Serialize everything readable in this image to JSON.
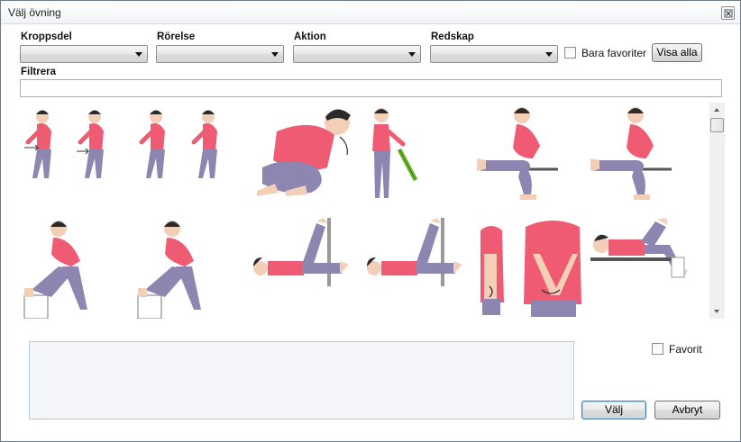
{
  "window": {
    "title": "Välj övning"
  },
  "filters": {
    "kroppsdel_label": "Kroppsdel",
    "kroppsdel_value": "",
    "rorelse_label": "Rörelse",
    "rorelse_value": "",
    "aktion_label": "Aktion",
    "aktion_value": "",
    "redskap_label": "Redskap",
    "redskap_value": "",
    "favorites_only_label": "Bara favoriter",
    "favorites_only_checked": false,
    "show_all_label": "Visa alla",
    "filter_label": "Filtrera",
    "filter_value": ""
  },
  "exercises": [
    {
      "icon": "forward-bend-arm-swing-icon"
    },
    {
      "icon": "forward-bend-arm-swing-icon"
    },
    {
      "icon": "kneeling-forward-bend-icon"
    },
    {
      "icon": "standing-stick-stretch-icon"
    },
    {
      "icon": "seated-leg-stretch-icon"
    },
    {
      "icon": "seated-leg-stretch-icon"
    },
    {
      "icon": "standing-leg-on-bench-icon"
    },
    {
      "icon": "standing-leg-on-bench-icon"
    },
    {
      "icon": "lying-leg-raise-on-wall-icon"
    },
    {
      "icon": "lying-leg-raise-on-wall-icon"
    },
    {
      "icon": "arm-rotation-icon"
    },
    {
      "icon": "lying-knee-to-chest-icon"
    }
  ],
  "detail": {
    "favorite_label": "Favorit",
    "favorite_checked": false,
    "description": ""
  },
  "actions": {
    "select_label": "Välj",
    "cancel_label": "Avbryt"
  },
  "colors": {
    "shirt": "#ee5b72",
    "pants": "#8c86b0",
    "skin": "#f3cfb8",
    "hair": "#2b2b2b"
  }
}
